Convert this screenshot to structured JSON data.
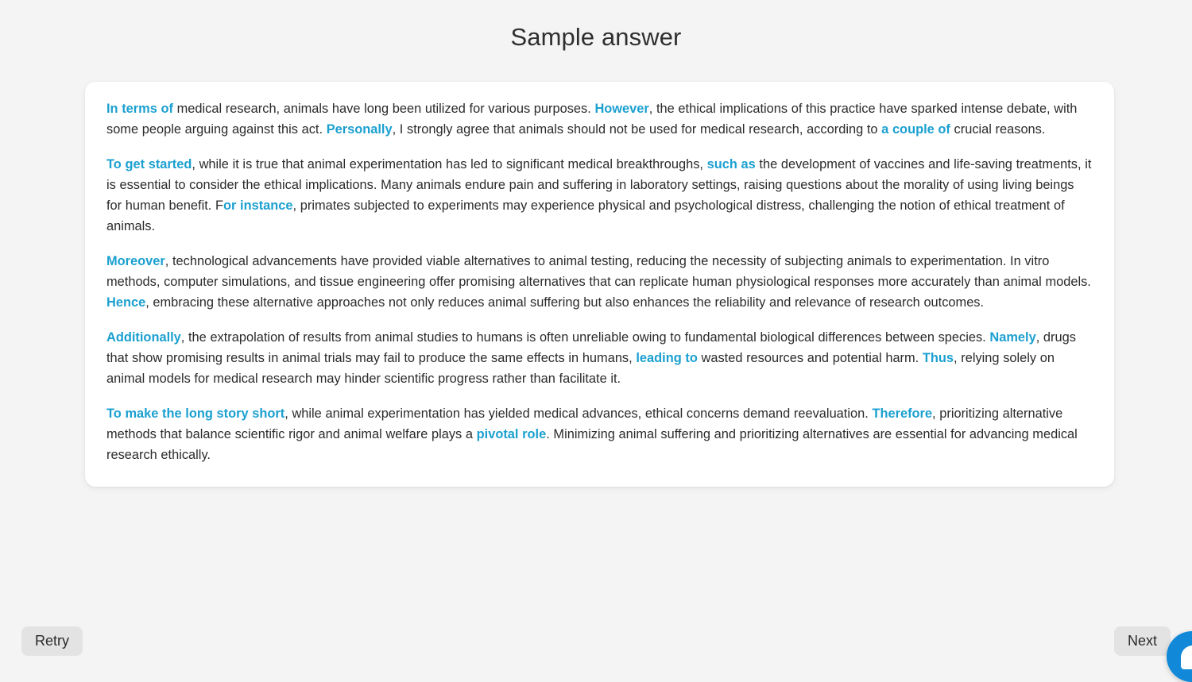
{
  "header": {
    "title": "Sample answer"
  },
  "answer": {
    "paragraphs": [
      {
        "id": "paragraph-1",
        "runs": [
          {
            "text": "In terms of",
            "highlight": true
          },
          {
            "text": " medical research, animals have long been utilized for various purposes. ",
            "highlight": false
          },
          {
            "text": "However",
            "highlight": true
          },
          {
            "text": ", the ethical implications of this practice have sparked intense debate, with some people arguing against this act. ",
            "highlight": false
          },
          {
            "text": "Personally",
            "highlight": true
          },
          {
            "text": ", I strongly agree that animals should not be used for medical research, according to ",
            "highlight": false
          },
          {
            "text": "a couple of",
            "highlight": true
          },
          {
            "text": " crucial reasons.",
            "highlight": false
          }
        ]
      },
      {
        "id": "paragraph-2",
        "runs": [
          {
            "text": "To get started",
            "highlight": true
          },
          {
            "text": ", while it is true that animal experimentation has led to significant medical breakthroughs, ",
            "highlight": false
          },
          {
            "text": "such as",
            "highlight": true
          },
          {
            "text": " the development of vaccines and life-saving treatments, it is essential to consider the ethical implications. Many animals endure pain and suffering in laboratory settings, raising questions about the morality of using living beings for human benefit. F",
            "highlight": false
          },
          {
            "text": "or instance",
            "highlight": true
          },
          {
            "text": ", primates subjected to experiments may experience physical and psychological distress, challenging the notion of ethical treatment of animals.",
            "highlight": false
          }
        ]
      },
      {
        "id": "paragraph-3",
        "runs": [
          {
            "text": "Moreover",
            "highlight": true
          },
          {
            "text": ", technological advancements have provided viable alternatives to animal testing, reducing the necessity of subjecting animals to experimentation. In vitro methods, computer simulations, and tissue engineering offer promising alternatives that can replicate human physiological responses more accurately than animal models. ",
            "highlight": false
          },
          {
            "text": "Hence",
            "highlight": true
          },
          {
            "text": ", embracing these alternative approaches not only reduces animal suffering but also enhances the reliability and relevance of research outcomes.",
            "highlight": false
          }
        ]
      },
      {
        "id": "paragraph-4",
        "runs": [
          {
            "text": "Additionally",
            "highlight": true
          },
          {
            "text": ", the extrapolation of results from animal studies to humans is often unreliable owing to fundamental biological differences between species. ",
            "highlight": false
          },
          {
            "text": "Namely",
            "highlight": true
          },
          {
            "text": ", drugs that show promising results in animal trials may fail to produce the same effects in humans, ",
            "highlight": false
          },
          {
            "text": "leading to",
            "highlight": true
          },
          {
            "text": " wasted resources and potential harm. ",
            "highlight": false
          },
          {
            "text": "Thus",
            "highlight": true
          },
          {
            "text": ", relying solely on animal models for medical research may hinder scientific progress rather than facilitate it.",
            "highlight": false
          }
        ]
      },
      {
        "id": "paragraph-5",
        "runs": [
          {
            "text": "To make the long story short",
            "highlight": true
          },
          {
            "text": ", while animal experimentation has yielded medical advances, ethical concerns demand reevaluation. ",
            "highlight": false
          },
          {
            "text": "Therefore",
            "highlight": true
          },
          {
            "text": ", prioritizing alternative methods that balance scientific rigor and animal welfare plays a ",
            "highlight": false
          },
          {
            "text": "pivotal role",
            "highlight": true
          },
          {
            "text": ". Minimizing animal suffering and prioritizing alternatives are essential for advancing medical research ethically.",
            "highlight": false
          }
        ]
      }
    ]
  },
  "footer": {
    "retry_label": "Retry",
    "next_label": "Next"
  },
  "chat": {
    "icon": "chat-bubble-icon"
  },
  "colors": {
    "highlight": "#1ba0d0",
    "page_background": "#f4f4f4",
    "card_background": "#ffffff",
    "button_background": "#e3e3e3",
    "chat_widget": "#1189d8",
    "text": "#2b2b2b"
  }
}
